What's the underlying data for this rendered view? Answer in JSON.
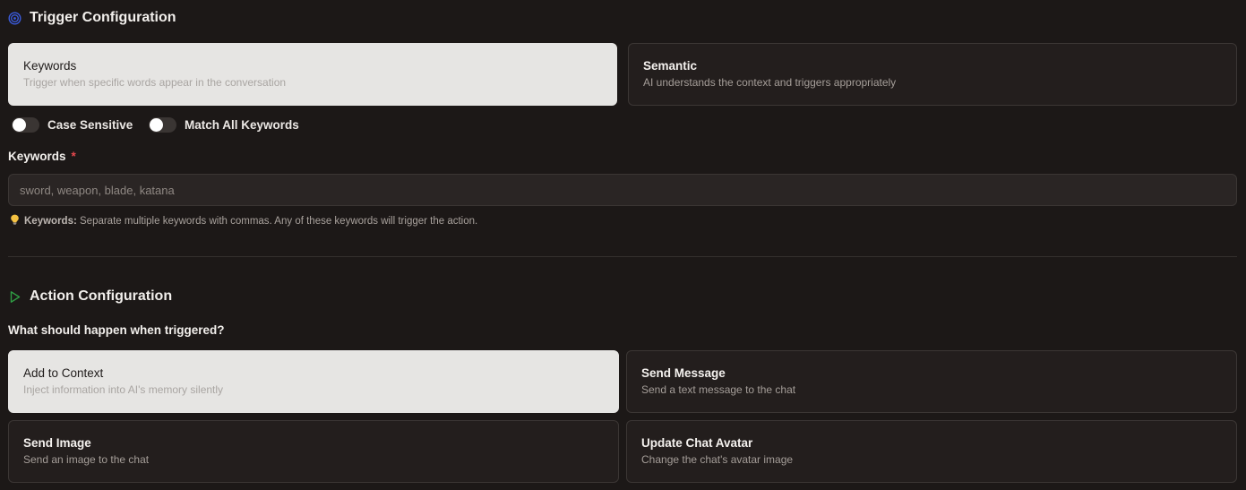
{
  "trigger": {
    "title": "Trigger Configuration",
    "modes": [
      {
        "title": "Keywords",
        "description": "Trigger when specific words appear in the conversation",
        "selected": true
      },
      {
        "title": "Semantic",
        "description": "AI understands the context and triggers appropriately",
        "selected": false
      }
    ],
    "toggles": {
      "case_sensitive": {
        "label": "Case Sensitive",
        "on": false
      },
      "match_all": {
        "label": "Match All Keywords",
        "on": false
      }
    },
    "keywords_field": {
      "label": "Keywords",
      "required_mark": "*",
      "value": "",
      "placeholder": "sword, weapon, blade, katana"
    },
    "hint": {
      "icon": "lightbulb-icon",
      "strong": "Keywords:",
      "text": "Separate multiple keywords with commas. Any of these keywords will trigger the action."
    }
  },
  "action": {
    "title": "Action Configuration",
    "question": "What should happen when triggered?",
    "options": [
      {
        "title": "Add to Context",
        "description": "Inject information into AI's memory silently",
        "selected": true
      },
      {
        "title": "Send Message",
        "description": "Send a text message to the chat",
        "selected": false
      },
      {
        "title": "Send Image",
        "description": "Send an image to the chat",
        "selected": false
      },
      {
        "title": "Update Chat Avatar",
        "description": "Change the chat's avatar image",
        "selected": false
      }
    ]
  },
  "colors": {
    "background": "#1c1817",
    "card": "#231e1d",
    "card_selected": "#e6e5e3",
    "trigger_icon": "#3b5bdb",
    "action_icon": "#2f9e44",
    "required": "#e5484d"
  }
}
